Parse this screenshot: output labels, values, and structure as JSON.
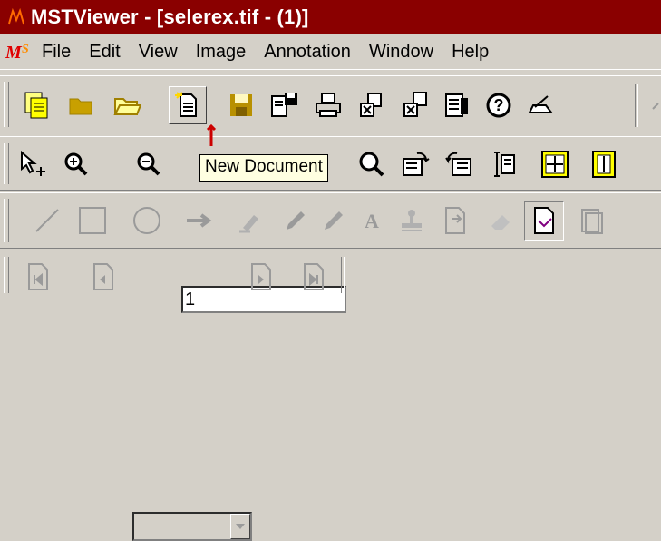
{
  "window": {
    "title": "MSTViewer - [selerex.tif - (1)]"
  },
  "menu": {
    "items": [
      "File",
      "Edit",
      "View",
      "Image",
      "Annotation",
      "Window",
      "Help"
    ]
  },
  "zoom": {
    "value": "1"
  },
  "tooltip": {
    "text": "New Document"
  },
  "page_select": {
    "value": ""
  },
  "colors": {
    "titlebar": "#8a0000",
    "toolbar_bg": "#d4d0c8",
    "tooltip_bg": "#ffffe1",
    "pointer_arrow": "#cc0000"
  },
  "toolbars": {
    "standard": [
      "new-window-icon",
      "open-folder-icon",
      "open-folder-outline-icon",
      "new-document-icon",
      "save-icon",
      "save-as-icon",
      "print-icon",
      "copy-page-icon",
      "copy-page-alt-icon",
      "properties-icon",
      "help-icon",
      "scan-icon"
    ],
    "view": [
      "select-tool-icon",
      "zoom-in-icon",
      "zoom-out-icon",
      "magnifier-icon",
      "rotate-right-icon",
      "rotate-left-icon",
      "fit-height-icon",
      "fit-window-icon",
      "fit-width-icon"
    ],
    "annotation": [
      "line-tool-icon",
      "rectangle-tool-icon",
      "ellipse-tool-icon",
      "arrow-tool-icon",
      "highlighter-icon",
      "pen-icon",
      "text-tool-icon",
      "stamp-icon",
      "attach-icon",
      "eraser-icon",
      "annotation-pointer-icon",
      "paste-icon"
    ],
    "navigation": [
      "first-page-icon",
      "previous-page-icon",
      "next-page-icon",
      "last-page-icon"
    ]
  }
}
